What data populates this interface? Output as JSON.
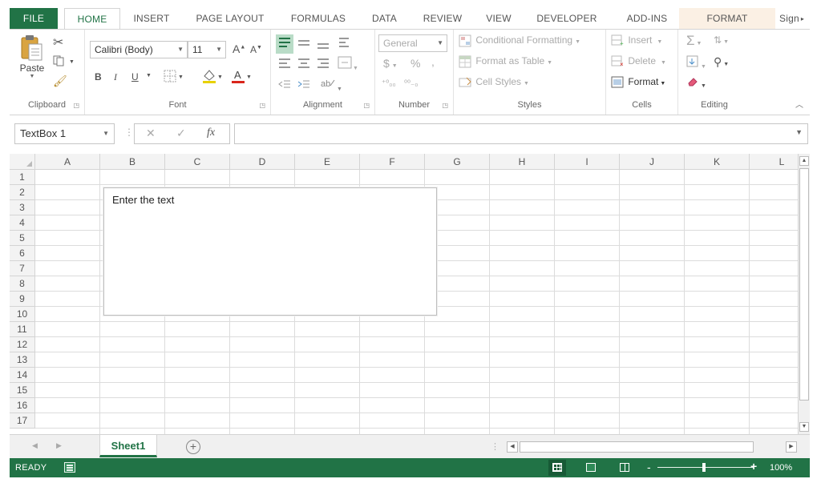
{
  "tabs": {
    "file": "FILE",
    "home": "HOME",
    "insert": "INSERT",
    "page_layout": "PAGE LAYOUT",
    "formulas": "FORMULAS",
    "data": "DATA",
    "review": "REVIEW",
    "view": "VIEW",
    "developer": "DEVELOPER",
    "add_ins": "ADD-INS",
    "format": "FORMAT",
    "signin": "Sign"
  },
  "ribbon": {
    "clipboard": {
      "label": "Clipboard",
      "paste": "Paste"
    },
    "font": {
      "label": "Font",
      "font_name": "Calibri (Body)",
      "font_size": "11",
      "bold": "B",
      "italic": "I",
      "underline": "U",
      "grow": "A",
      "shrink": "A"
    },
    "alignment": {
      "label": "Alignment"
    },
    "number": {
      "label": "Number",
      "format": "General",
      "currency": "$",
      "percent": "%",
      "comma": ","
    },
    "styles": {
      "label": "Styles",
      "conditional": "Conditional Formatting",
      "format_table": "Format as Table",
      "cell_styles": "Cell Styles"
    },
    "cells": {
      "label": "Cells",
      "insert": "Insert",
      "delete": "Delete",
      "format": "Format"
    },
    "editing": {
      "label": "Editing"
    }
  },
  "formula_bar": {
    "name_box": "TextBox 1",
    "cancel": "✕",
    "enter": "✓",
    "fx": "fx",
    "value": ""
  },
  "grid": {
    "columns": [
      "A",
      "B",
      "C",
      "D",
      "E",
      "F",
      "G",
      "H",
      "I",
      "J",
      "K",
      "L"
    ],
    "rows": [
      "1",
      "2",
      "3",
      "4",
      "5",
      "6",
      "7",
      "8",
      "9",
      "10",
      "11",
      "12",
      "13",
      "14",
      "15",
      "16",
      "17"
    ]
  },
  "textbox": {
    "text": "Enter the text"
  },
  "sheets": {
    "active": "Sheet1",
    "add": "+"
  },
  "status": {
    "ready": "READY",
    "zoom_minus": "-",
    "zoom_plus": "+",
    "zoom": "100%"
  },
  "colors": {
    "accent": "#217346",
    "format_tab_bg": "#fbf0e4"
  }
}
